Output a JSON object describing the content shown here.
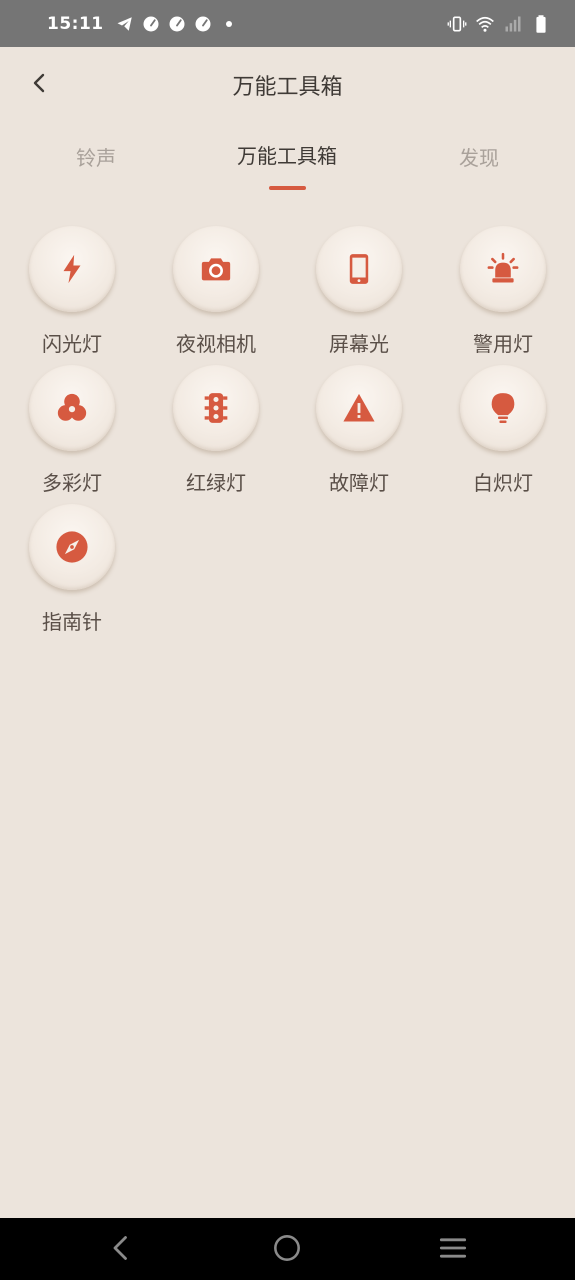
{
  "status_bar": {
    "time": "15:11",
    "left_icons": [
      "telegram-icon",
      "speedometer-icon",
      "speedometer-icon",
      "speedometer-icon",
      "dot-icon"
    ],
    "right_icons": [
      "vibrate-icon",
      "wifi-icon",
      "signal-icon",
      "battery-icon"
    ]
  },
  "header": {
    "title": "万能工具箱",
    "back_icon": "chevron-left-icon"
  },
  "tabs": [
    {
      "label": "铃声",
      "active": false
    },
    {
      "label": "万能工具箱",
      "active": true
    },
    {
      "label": "发现",
      "active": false
    }
  ],
  "tools": [
    {
      "label": "闪光灯",
      "icon": "flash-icon"
    },
    {
      "label": "夜视相机",
      "icon": "camera-icon"
    },
    {
      "label": "屏幕光",
      "icon": "phone-icon"
    },
    {
      "label": "警用灯",
      "icon": "siren-icon"
    },
    {
      "label": "多彩灯",
      "icon": "color-wheel-icon"
    },
    {
      "label": "红绿灯",
      "icon": "traffic-light-icon"
    },
    {
      "label": "故障灯",
      "icon": "warning-icon"
    },
    {
      "label": "白炽灯",
      "icon": "bulb-icon"
    },
    {
      "label": "指南针",
      "icon": "compass-icon"
    }
  ],
  "colors": {
    "background": "#ece4dc",
    "accent": "#d65a40",
    "status_bar": "#757575",
    "nav_bar": "#000000"
  },
  "nav": [
    "back-icon",
    "home-icon",
    "menu-icon"
  ]
}
